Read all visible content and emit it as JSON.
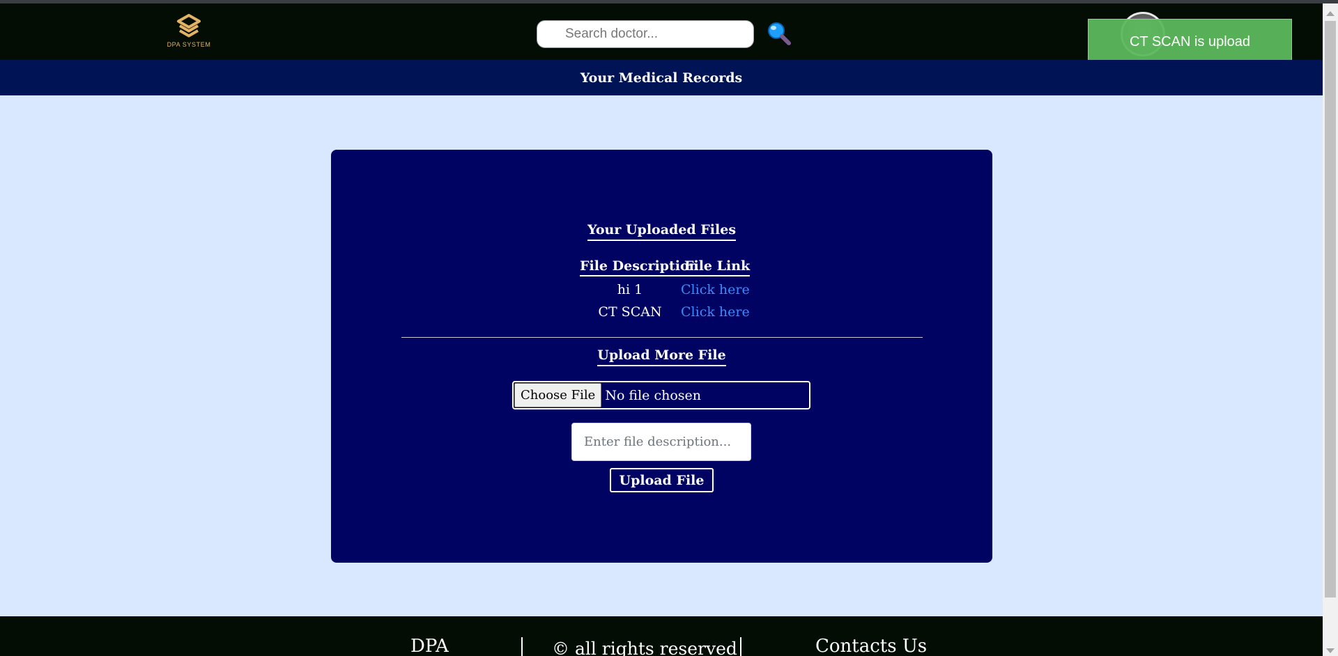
{
  "header": {
    "logo_text": "DPA SYSTEM",
    "search_placeholder": "Search doctor...",
    "search_icon": "magnifier-icon",
    "avatar_icon": "user-avatar"
  },
  "toast": {
    "message": "CT SCAN is upload",
    "color": "#5cb85c"
  },
  "subnav": {
    "title": "Your Medical Records"
  },
  "panel": {
    "uploaded_title": "Your Uploaded Files",
    "columns": {
      "description": "File Description",
      "link": "File Link"
    },
    "files": [
      {
        "description": "hi 1",
        "link_text": "Click here"
      },
      {
        "description": "CT SCAN",
        "link_text": "Click here"
      }
    ],
    "upload_title": "Upload More File",
    "choose_file_label": "Choose File",
    "file_status": "No file chosen",
    "description_placeholder": "Enter file description...",
    "upload_button": "Upload File"
  },
  "footer": {
    "brand": "DPA",
    "rights": "© all rights reserved",
    "contacts": "Contacts Us"
  },
  "colors": {
    "header_bg": "#030d04",
    "subnav_bg": "#001354",
    "page_bg": "#d9e8ff",
    "panel_bg": "#000361",
    "link": "#3d8bff",
    "logo": "#e3b365"
  }
}
